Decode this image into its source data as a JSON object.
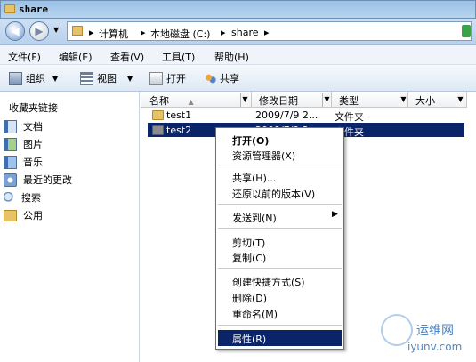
{
  "window": {
    "title": "share"
  },
  "address": {
    "crumbs": [
      "计算机",
      "本地磁盘 (C:)",
      "share"
    ],
    "sep": "▸"
  },
  "menubar": [
    "文件(F)",
    "编辑(E)",
    "查看(V)",
    "工具(T)",
    "帮助(H)"
  ],
  "toolbar": {
    "organize": "组织",
    "views": "视图",
    "open": "打开",
    "share": "共享"
  },
  "sidebar": {
    "title": "收藏夹链接",
    "items": [
      "文档",
      "图片",
      "音乐",
      "最近的更改",
      "搜索",
      "公用"
    ]
  },
  "columns": [
    "名称",
    "修改日期",
    "类型",
    "大小"
  ],
  "files": [
    {
      "name": "test1",
      "date": "2009/7/9 2...",
      "type": "文件夹"
    },
    {
      "name": "test2",
      "date": "2009/7/9 2...",
      "type": "文件夹"
    }
  ],
  "context_menu": {
    "open": "打开(O)",
    "explorer": "资源管理器(X)",
    "share": "共享(H)...",
    "restore": "还原以前的版本(V)",
    "send_to": "发送到(N)",
    "cut": "剪切(T)",
    "copy": "复制(C)",
    "shortcut": "创建快捷方式(S)",
    "delete": "删除(D)",
    "rename": "重命名(M)",
    "properties": "属性(R)"
  },
  "watermark": {
    "text1": "运维网",
    "text2": "iyunv.com"
  },
  "colors": {
    "highlight": "#0a246a",
    "sidebar_link": "#000000"
  }
}
